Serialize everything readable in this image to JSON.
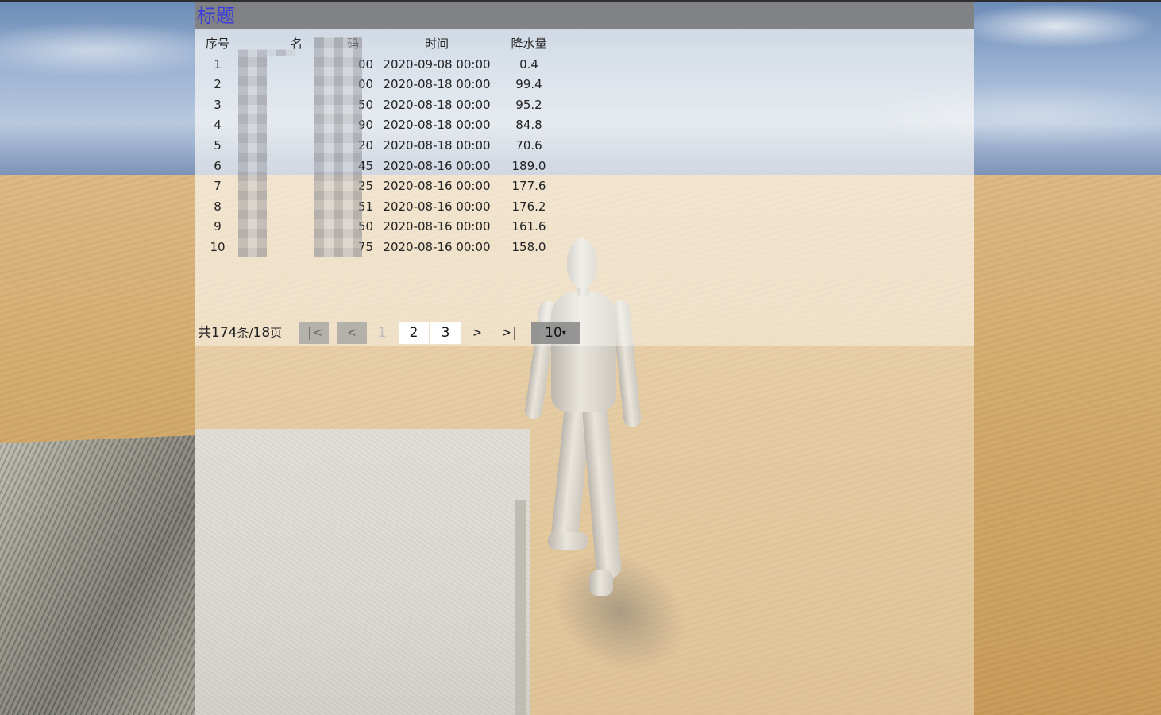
{
  "panel": {
    "title": "标题"
  },
  "table": {
    "headers": {
      "index": "序号",
      "name": "名",
      "code": "码",
      "time": "时间",
      "rainfall": "降水量"
    },
    "rows": [
      {
        "index": "1",
        "name": "",
        "code": "00",
        "time": "2020-09-08 00:00",
        "rainfall": "0.4"
      },
      {
        "index": "2",
        "name": "",
        "code": "00",
        "time": "2020-08-18 00:00",
        "rainfall": "99.4"
      },
      {
        "index": "3",
        "name": "",
        "code": "50",
        "time": "2020-08-18 00:00",
        "rainfall": "95.2"
      },
      {
        "index": "4",
        "name": "",
        "code": "90",
        "time": "2020-08-18 00:00",
        "rainfall": "84.8"
      },
      {
        "index": "5",
        "name": "",
        "code": "20",
        "time": "2020-08-18 00:00",
        "rainfall": "70.6"
      },
      {
        "index": "6",
        "name": "",
        "code": "45",
        "time": "2020-08-16 00:00",
        "rainfall": "189.0"
      },
      {
        "index": "7",
        "name": "",
        "code": "25",
        "time": "2020-08-16 00:00",
        "rainfall": "177.6"
      },
      {
        "index": "8",
        "name": "",
        "code": "51",
        "time": "2020-08-16 00:00",
        "rainfall": "176.2"
      },
      {
        "index": "9",
        "name": "",
        "code": "50",
        "time": "2020-08-16 00:00",
        "rainfall": "161.6"
      },
      {
        "index": "10",
        "name": "",
        "code": "75",
        "time": "2020-08-16 00:00",
        "rainfall": "158.0"
      }
    ]
  },
  "pagination": {
    "total_prefix": "共",
    "total_count": "174",
    "total_mid": "条/",
    "total_pages": "18",
    "total_suffix": "页",
    "first_label": "|<",
    "prev_label": "<",
    "pages": [
      "1",
      "2",
      "3"
    ],
    "current_page": "1",
    "next_label": ">",
    "last_label": ">|",
    "page_size": "10",
    "page_size_caret": "▾"
  },
  "colors": {
    "title_text": "#3b3be0",
    "title_bar": "#808080",
    "disabled_button": "#a0a0a0",
    "page_button": "#ffffff"
  }
}
